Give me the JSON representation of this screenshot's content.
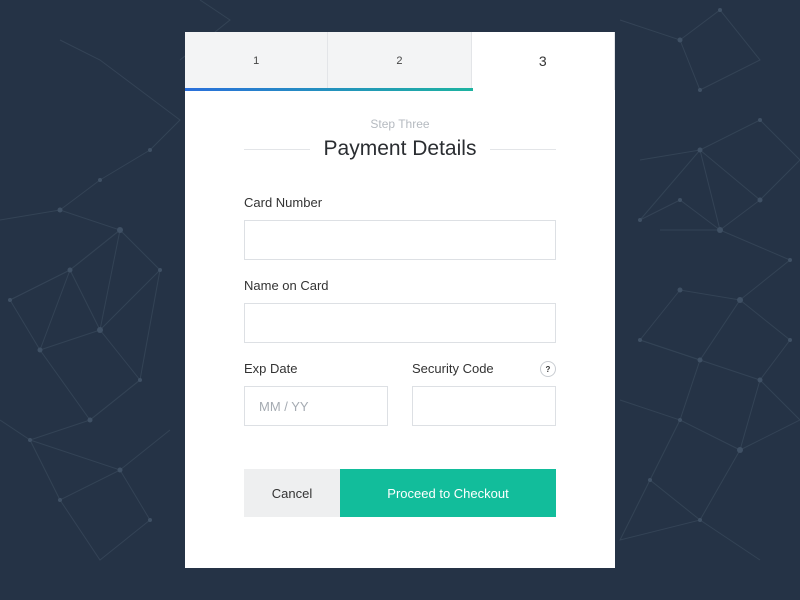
{
  "steps": [
    {
      "label": "1",
      "active": false
    },
    {
      "label": "2",
      "active": false
    },
    {
      "label": "3",
      "active": true
    }
  ],
  "progress": {
    "completed_fraction": 0.67
  },
  "header": {
    "step_label": "Step Three",
    "title": "Payment Details"
  },
  "form": {
    "card_number": {
      "label": "Card Number",
      "value": "",
      "placeholder": ""
    },
    "name_on_card": {
      "label": "Name on Card",
      "value": "",
      "placeholder": ""
    },
    "exp_date": {
      "label": "Exp Date",
      "value": "",
      "placeholder": "MM / YY"
    },
    "security_code": {
      "label": "Security Code",
      "value": "",
      "placeholder": "",
      "help_glyph": "?"
    }
  },
  "actions": {
    "cancel_label": "Cancel",
    "proceed_label": "Proceed to Checkout"
  },
  "colors": {
    "background": "#253346",
    "accent": "#12bd9b",
    "progress_start": "#2a6fdb",
    "progress_end": "#1db3a0"
  }
}
